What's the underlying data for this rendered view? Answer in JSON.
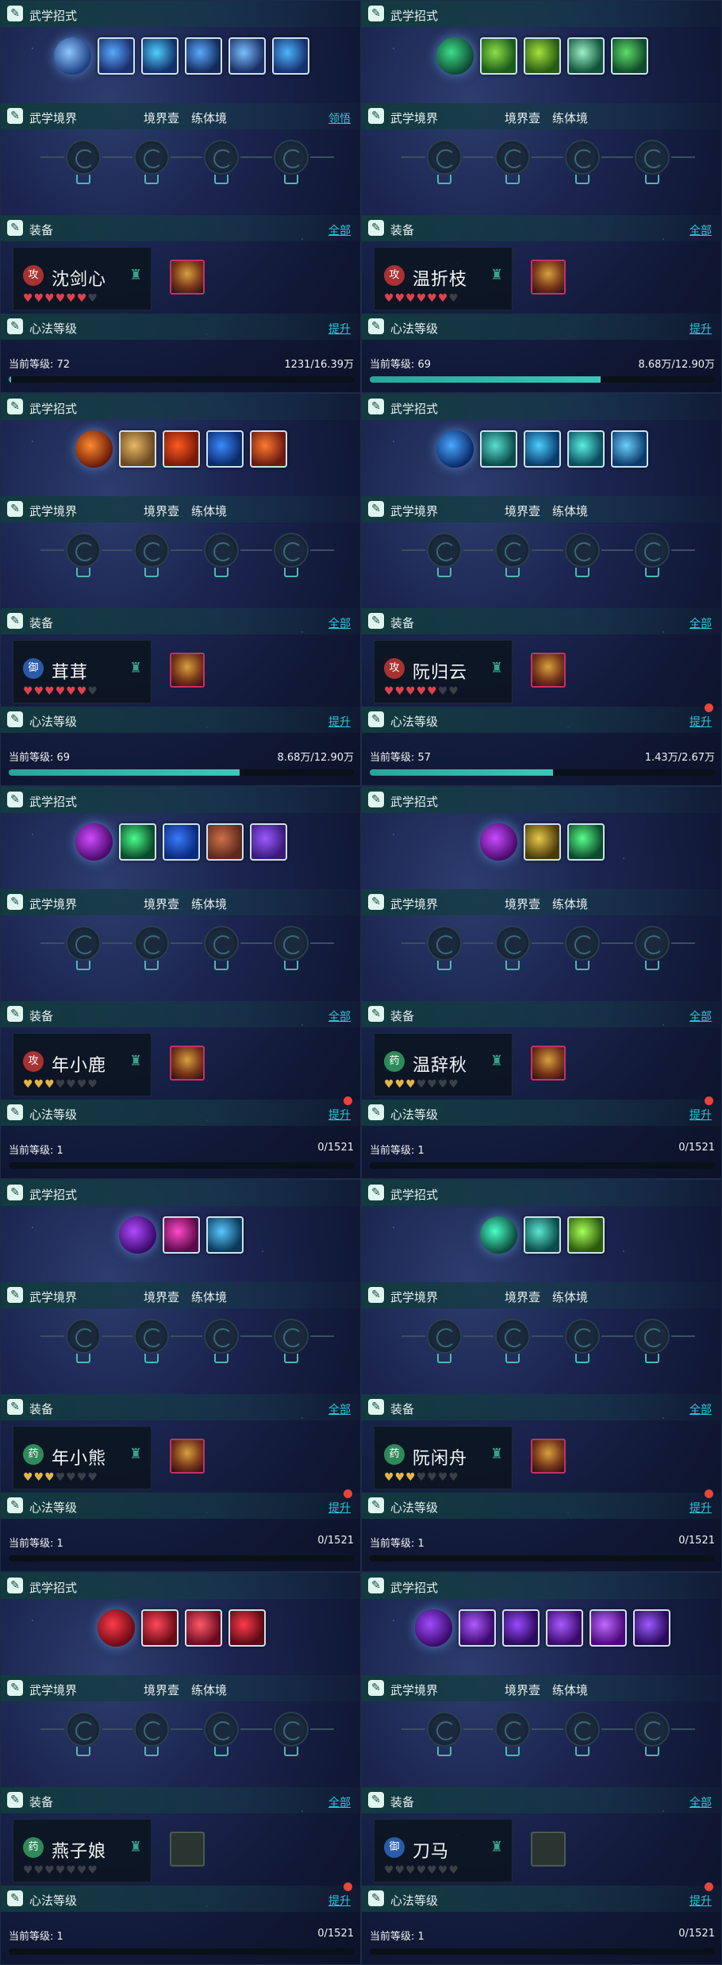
{
  "labels": {
    "skills": "武学招式",
    "realm": "武学境界",
    "realm_stage": "境界壹",
    "realm_type": "练体境",
    "equip": "装备",
    "all": "全部",
    "mind": "心法等级",
    "upgrade": "提升",
    "level_prefix": "当前等级:"
  },
  "icons": {
    "section": "scroll-icon",
    "heart": "heart-icon",
    "hat": "hat-icon",
    "node": "realm-node-icon"
  },
  "colors": {
    "heart_red": "#e0414d",
    "heart_gold": "#e3b54a",
    "heart_empty": "#3a3f48",
    "accent": "#2fc6d8"
  },
  "cards": [
    {
      "realm_link": "领悟",
      "seal": "攻",
      "name": "沈剑心",
      "heart_color": "red",
      "hearts_filled": 6,
      "level": "72",
      "xp": "1231/16.39万",
      "progress": 0.0075,
      "badge": false,
      "gear_empty": false,
      "skills": [
        [
          "#1e3f82",
          "#8ec6ff"
        ],
        [
          "#1b2f6e",
          "#59a8ff"
        ],
        [
          "#11306a",
          "#4ed0ff"
        ],
        [
          "#142a5a",
          "#5aaaff"
        ],
        [
          "#1c2e66",
          "#78c0ff"
        ],
        [
          "#16306e",
          "#4fb4ff"
        ]
      ]
    },
    {
      "realm_link": "",
      "seal": "攻",
      "name": "温折枝",
      "heart_color": "red",
      "hearts_filled": 6,
      "level": "69",
      "xp": "8.68万/12.90万",
      "progress": 0.67,
      "badge": false,
      "gear_empty": false,
      "skills": [
        [
          "#0c4a32",
          "#3fdc8a"
        ],
        [
          "#1a5a1a",
          "#8ee046"
        ],
        [
          "#275a14",
          "#a5e23c"
        ],
        [
          "#10523a",
          "#9ef0c8"
        ],
        [
          "#0f4a2a",
          "#5ede6a"
        ]
      ]
    },
    {
      "realm_link": "",
      "seal": "御",
      "name": "茸茸",
      "heart_color": "red",
      "hearts_filled": 6,
      "level": "69",
      "xp": "8.68万/12.90万",
      "progress": 0.67,
      "badge": false,
      "gear_empty": false,
      "skills": [
        [
          "#6a1a08",
          "#ff8a30"
        ],
        [
          "#6a4a20",
          "#e8b868"
        ],
        [
          "#7a1a08",
          "#ff5a20"
        ],
        [
          "#0a2a6a",
          "#3a8aff"
        ],
        [
          "#6a1a10",
          "#ff7a30"
        ]
      ]
    },
    {
      "realm_link": "",
      "seal": "攻",
      "name": "阮归云",
      "heart_color": "red",
      "hearts_filled": 5,
      "level": "57",
      "xp": "1.43万/2.67万",
      "progress": 0.53,
      "badge": true,
      "gear_empty": false,
      "skills": [
        [
          "#0a2a6a",
          "#4aa8ff"
        ],
        [
          "#0a4a4a",
          "#5ae0d0"
        ],
        [
          "#0a3a6a",
          "#4ad0ff"
        ],
        [
          "#0a4a5a",
          "#5af0e0"
        ],
        [
          "#0a3a6a",
          "#6ad0ff"
        ]
      ]
    },
    {
      "realm_link": "",
      "seal": "攻",
      "name": "年小鹿",
      "heart_color": "gold",
      "hearts_filled": 3,
      "level": "1",
      "xp": "0/1521",
      "progress": 0,
      "badge": true,
      "gear_empty": false,
      "skills": [
        [
          "#4a0a6a",
          "#d04aff"
        ],
        [
          "#0a4a2a",
          "#4aff8a"
        ],
        [
          "#0a2a7a",
          "#3a7aff"
        ],
        [
          "#5a2a1a",
          "#d0704a"
        ],
        [
          "#3a1a7a",
          "#9a5aff"
        ]
      ]
    },
    {
      "realm_link": "",
      "seal": "药",
      "name": "温辞秋",
      "heart_color": "gold",
      "hearts_filled": 3,
      "level": "1",
      "xp": "0/1521",
      "progress": 0,
      "badge": true,
      "gear_empty": false,
      "skills": [
        [
          "#4a0a6a",
          "#c84aff"
        ],
        [
          "#4a3a0a",
          "#e8c84a"
        ],
        [
          "#0a4a2a",
          "#5aff8a"
        ]
      ]
    },
    {
      "realm_link": "",
      "seal": "药",
      "name": "年小熊",
      "heart_color": "gold",
      "hearts_filled": 3,
      "level": "1",
      "xp": "0/1521",
      "progress": 0,
      "badge": true,
      "gear_empty": false,
      "skills": [
        [
          "#3a0a6a",
          "#b04aff"
        ],
        [
          "#5a0a4a",
          "#ff4ac8"
        ],
        [
          "#0a3a5a",
          "#5ac8ff"
        ]
      ]
    },
    {
      "realm_link": "",
      "seal": "药",
      "name": "阮闲舟",
      "heart_color": "gold",
      "hearts_filled": 3,
      "level": "1",
      "xp": "0/1521",
      "progress": 0,
      "badge": true,
      "gear_empty": false,
      "skills": [
        [
          "#0a4a3a",
          "#4affc8"
        ],
        [
          "#0a4a4a",
          "#5ae8d0"
        ],
        [
          "#2a5a0a",
          "#a8ff5a"
        ]
      ]
    },
    {
      "realm_link": "",
      "seal": "药",
      "name": "燕子娘",
      "heart_color": "gold",
      "hearts_filled": 0,
      "level": "1",
      "xp": "0/1521",
      "progress": 0,
      "badge": true,
      "gear_empty": true,
      "skills": [
        [
          "#6a0a14",
          "#ff3a4a"
        ],
        [
          "#6a0a14",
          "#ff4a5a"
        ],
        [
          "#6a0a20",
          "#ff5a6a"
        ],
        [
          "#5a0a14",
          "#ff3a4a"
        ]
      ]
    },
    {
      "realm_link": "",
      "seal": "御",
      "name": "刀马",
      "heart_color": "gold",
      "hearts_filled": 0,
      "level": "1",
      "xp": "0/1521",
      "progress": 0,
      "badge": true,
      "gear_empty": true,
      "skills": [
        [
          "#3a0a6a",
          "#a04aff"
        ],
        [
          "#3a0a6a",
          "#b05aff"
        ],
        [
          "#2a0a5a",
          "#9a4aff"
        ],
        [
          "#3a0a6a",
          "#a85aff"
        ],
        [
          "#4a0a7a",
          "#c06aff"
        ],
        [
          "#2a0a5a",
          "#9a5aff"
        ]
      ]
    }
  ]
}
